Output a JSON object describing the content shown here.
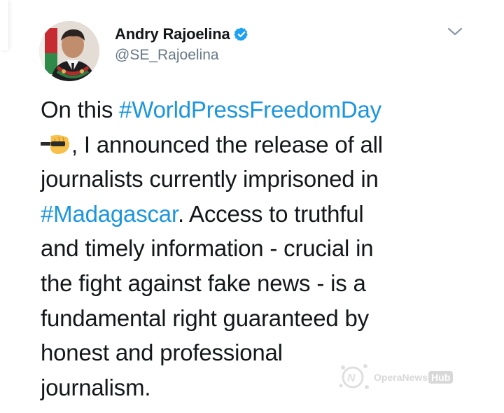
{
  "tweet": {
    "author": {
      "display_name": "Andry Rajoelina",
      "handle": "@SE_Rajoelina",
      "verified": true,
      "avatar_icon": "profile-photo"
    },
    "menu_icon": "chevron-down-icon",
    "body": {
      "lines": [
        [
          {
            "text": "On this ",
            "type": "text"
          },
          {
            "text": "#WorldPressFreedomDay",
            "type": "hashtag"
          }
        ],
        [
          {
            "icon": "fist-with-pen-emoji",
            "type": "emoji"
          },
          {
            "text": ", I announced the release of all",
            "type": "text"
          }
        ],
        [
          {
            "text": "journalists currently imprisoned in",
            "type": "text"
          }
        ],
        [
          {
            "text": "#Madagascar",
            "type": "hashtag"
          },
          {
            "text": ". Access to truthful",
            "type": "text"
          }
        ],
        [
          {
            "text": "and timely information - crucial in",
            "type": "text"
          }
        ],
        [
          {
            "text": "the fight against fake news - is a",
            "type": "text"
          }
        ],
        [
          {
            "text": "fundamental right guaranteed by",
            "type": "text"
          }
        ],
        [
          {
            "text": "honest and professional",
            "type": "text"
          }
        ],
        [
          {
            "text": "journalism.",
            "type": "text"
          }
        ]
      ]
    }
  },
  "watermark": {
    "brand": "OperaNews",
    "suffix": "Hub",
    "icon": "opera-news-logo-icon"
  },
  "colors": {
    "text": "#14171a",
    "secondary": "#657786",
    "hashtag": "#1b95e0",
    "verified": "#1da1f2"
  }
}
